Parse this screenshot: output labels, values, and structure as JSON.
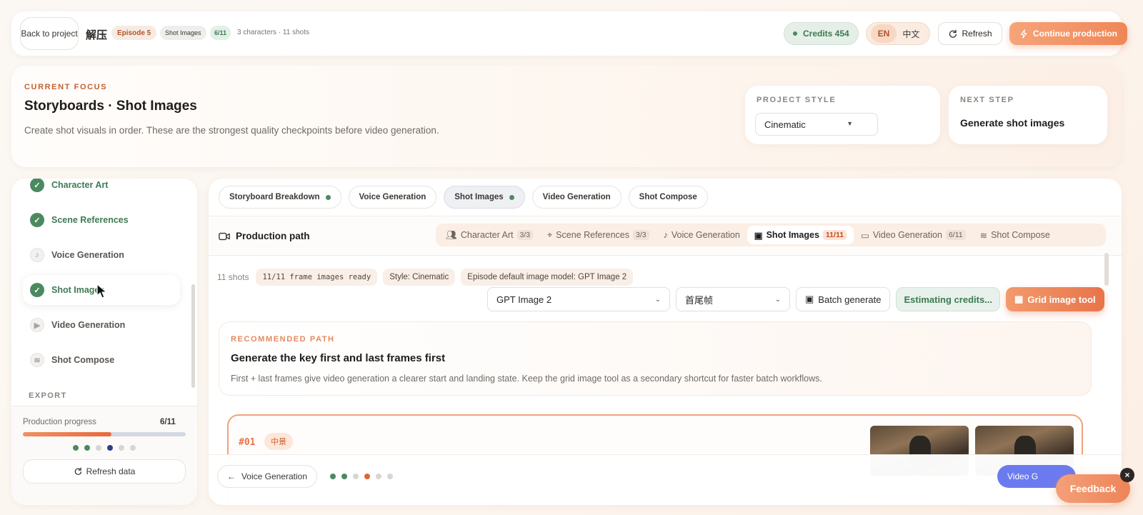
{
  "topbar": {
    "back_label": "Back to project",
    "title": "解压",
    "episode": "Episode 5",
    "stage": "Shot Images",
    "stage_count": "6/11",
    "meta": "3 characters · 11 shots",
    "credits": "Credits 454",
    "lang_en": "EN",
    "lang_zh": "中文",
    "refresh": "Refresh",
    "continue": "Continue production"
  },
  "focus": {
    "eyebrow": "CURRENT FOCUS",
    "title": "Storyboards · Shot Images",
    "desc": "Create shot visuals in order. These are the strongest quality checkpoints before video generation.",
    "project_style_label": "PROJECT STYLE",
    "project_style_value": "Cinematic",
    "next_step_label": "NEXT STEP",
    "next_step_value": "Generate shot images"
  },
  "sidebar": {
    "items": [
      {
        "label": "Character Art",
        "status": "done"
      },
      {
        "label": "Scene References",
        "status": "done"
      },
      {
        "label": "Voice Generation",
        "status": "todo"
      },
      {
        "label": "Shot Images",
        "status": "done"
      },
      {
        "label": "Video Generation",
        "status": "todo"
      },
      {
        "label": "Shot Compose",
        "status": "todo"
      }
    ],
    "export_label": "EXPORT",
    "progress_label": "Production progress",
    "progress_count": "6/11",
    "progress_fraction": 0.545,
    "refresh_data": "Refresh data"
  },
  "main": {
    "tabs": [
      {
        "label": "Storyboard Breakdown",
        "done": true
      },
      {
        "label": "Voice Generation",
        "done": false
      },
      {
        "label": "Shot Images",
        "done": true
      },
      {
        "label": "Video Generation",
        "done": false
      },
      {
        "label": "Shot Compose",
        "done": false
      }
    ],
    "production_path_label": "Production path",
    "path_steps": [
      {
        "label": "Character Art",
        "count": "3/3"
      },
      {
        "label": "Scene References",
        "count": "3/3"
      },
      {
        "label": "Voice Generation",
        "count": ""
      },
      {
        "label": "Shot Images",
        "count": "11/11"
      },
      {
        "label": "Video Generation",
        "count": "6/11"
      },
      {
        "label": "Shot Compose",
        "count": ""
      }
    ],
    "shots_count": "11 shots",
    "frames_ready": "11/11 frame images ready",
    "style_chip": "Style: Cinematic",
    "model_chip": "Episode default image model: GPT Image 2",
    "model_select": "GPT Image 2",
    "frame_select": "首尾帧",
    "batch_generate": "Batch generate",
    "estimating": "Estimating credits...",
    "grid_tool": "Grid image tool",
    "rec_eyebrow": "RECOMMENDED PATH",
    "rec_title": "Generate the key first and last frames first",
    "rec_desc": "First + last frames give video generation a clearer start and landing state. Keep the grid image tool as a secondary shortcut for faster batch workflows.",
    "shot_num": "#01",
    "shot_tag": "中景",
    "back_voice": "Voice Generation",
    "video_pill": "Video G"
  },
  "feedback": "Feedback",
  "colors": {
    "accent": "#ef8757",
    "success": "#4b8a60",
    "progress_fill": "#e76a3c",
    "indigo": "#6b7bef"
  }
}
